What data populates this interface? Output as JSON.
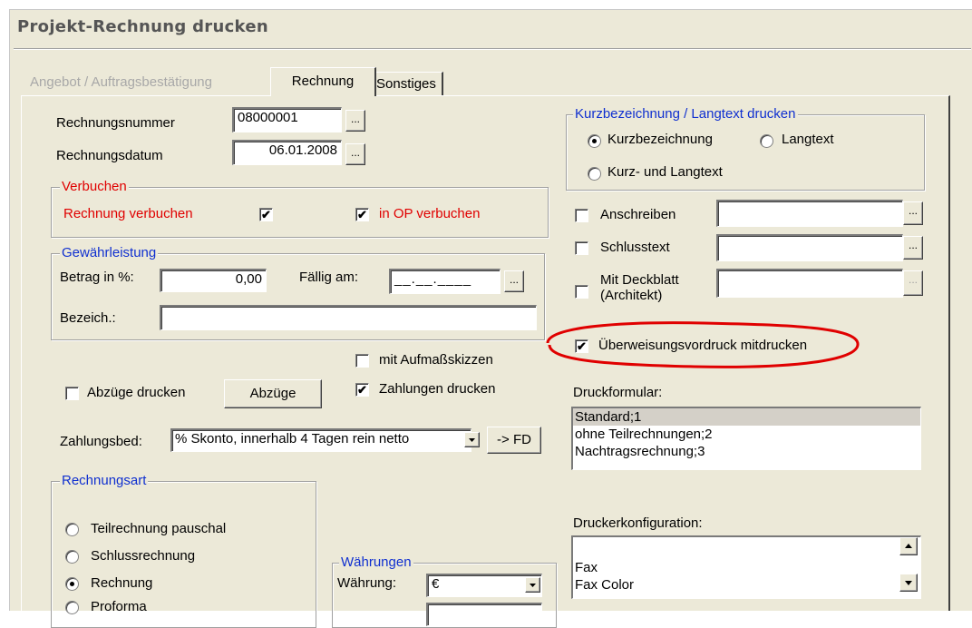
{
  "window": {
    "title": "Projekt-Rechnung drucken"
  },
  "tabs": [
    {
      "label": "Angebot / Auftragsbestätigung"
    },
    {
      "label": "Rechnung"
    },
    {
      "label": "Sonstiges"
    }
  ],
  "invoice": {
    "number_label": "Rechnungsnummer",
    "number_value": "08000001",
    "date_label": "Rechnungsdatum",
    "date_value": "06.01.2008",
    "browse_label": "..."
  },
  "verbuchen": {
    "legend": "Verbuchen",
    "invoice_label": "Rechnung verbuchen",
    "invoice_checked": true,
    "op_label": "in OP verbuchen",
    "op_checked": true
  },
  "warranty": {
    "legend": "Gewährleistung",
    "amount_label": "Betrag in %:",
    "amount_value": "0,00",
    "due_label": "Fällig am:",
    "due_value": "__.__.____",
    "desc_label": "Bezeich.:",
    "desc_value": ""
  },
  "options": {
    "sketches_label": "mit Aufmaßskizzen",
    "sketches_checked": false,
    "deductions_label": "Abzüge drucken",
    "deductions_checked": false,
    "deductions_button": "Abzüge",
    "payments_label": "Zahlungen drucken",
    "payments_checked": true
  },
  "payment_terms": {
    "label": "Zahlungsbed:",
    "value": "% Skonto, innerhalb 4 Tagen rein netto",
    "fd_button": "-> FD"
  },
  "invoice_type": {
    "legend": "Rechnungsart",
    "options": [
      {
        "label": "Teilrechnung pauschal",
        "selected": false
      },
      {
        "label": "Schlussrechnung",
        "selected": false
      },
      {
        "label": "Rechnung",
        "selected": true
      },
      {
        "label": "Proforma",
        "selected": false
      }
    ]
  },
  "currency": {
    "legend": "Währungen",
    "label": "Währung:",
    "value": "€"
  },
  "text_print": {
    "legend": "Kurzbezeichnung / Langtext drucken",
    "options": [
      {
        "label": "Kurzbezeichnung",
        "selected": true
      },
      {
        "label": "Langtext",
        "selected": false
      },
      {
        "label": "Kurz- und Langtext",
        "selected": false
      }
    ]
  },
  "extras": [
    {
      "label": "Anschreiben",
      "checked": false,
      "value": ""
    },
    {
      "label": "Schlusstext",
      "checked": false,
      "value": ""
    },
    {
      "label": "Mit Deckblatt (Architekt)",
      "checked": false,
      "value": ""
    }
  ],
  "transfer": {
    "label": "Überweisungsvordruck mitdrucken",
    "checked": true,
    "highlight_color": "#e00000"
  },
  "print_form": {
    "label": "Druckformular:",
    "items": [
      "Standard;1",
      "ohne Teilrechnungen;2",
      "Nachtragsrechnung;3"
    ],
    "selected_index": 0
  },
  "printer_config": {
    "label": "Druckerkonfiguration:",
    "items": [
      "Fax",
      "Fax Color"
    ]
  },
  "colors": {
    "accent_blue": "#1030d0",
    "accent_red": "#e00000",
    "face": "#ece9d8"
  }
}
